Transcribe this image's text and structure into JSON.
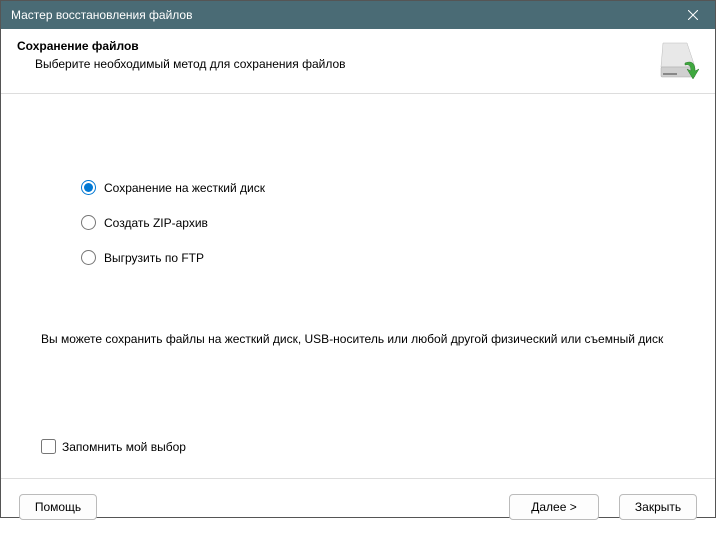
{
  "titlebar": {
    "title": "Мастер восстановления файлов"
  },
  "header": {
    "title": "Сохранение файлов",
    "subtitle": "Выберите необходимый метод для сохранения файлов"
  },
  "options": {
    "items": [
      {
        "label": "Сохранение на жесткий диск",
        "checked": true
      },
      {
        "label": "Создать ZIP-архив",
        "checked": false
      },
      {
        "label": "Выгрузить по FTP",
        "checked": false
      }
    ]
  },
  "description": "Вы можете сохранить файлы на жесткий диск, USB-носитель или любой другой физический или съемный диск",
  "remember": {
    "label": "Запомнить мой выбор",
    "checked": false
  },
  "footer": {
    "help": "Помощь",
    "next": "Далее >",
    "close": "Закрыть"
  }
}
